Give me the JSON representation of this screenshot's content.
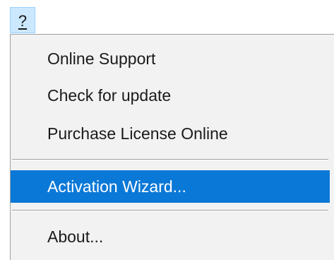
{
  "menubar": {
    "help_label": "?"
  },
  "menu": {
    "items": [
      {
        "label": "Online Support"
      },
      {
        "label": "Check for update"
      },
      {
        "label": "Purchase License Online"
      },
      {
        "label": "Activation Wizard..."
      },
      {
        "label": "About..."
      }
    ],
    "highlighted_item": "Activation Wizard..."
  },
  "colors": {
    "menu_background": "#f2f2f2",
    "highlight": "#0a78d7",
    "menubar_hover": "#cce8ff"
  }
}
